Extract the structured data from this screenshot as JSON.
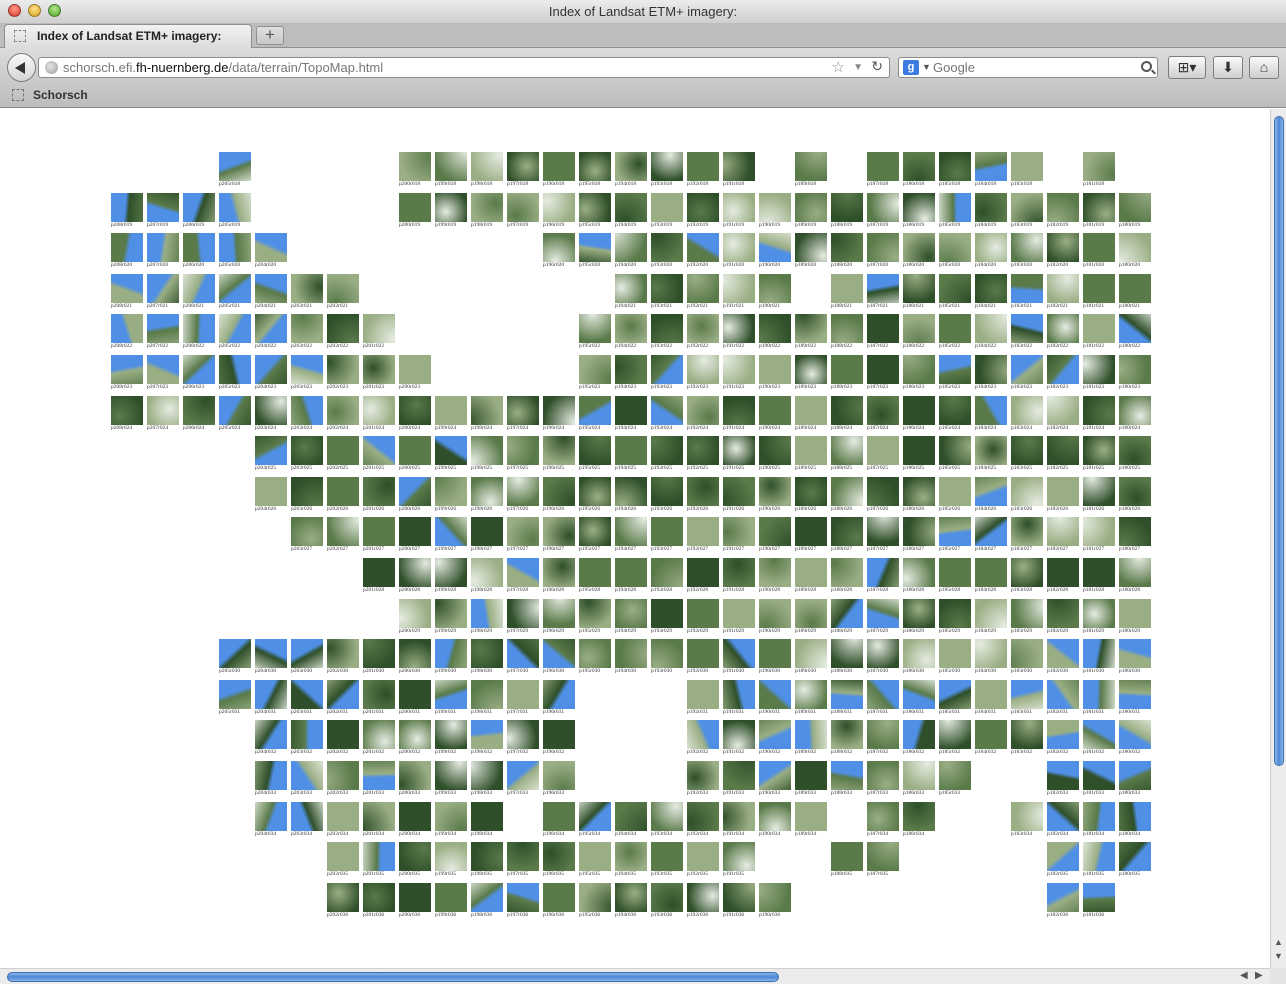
{
  "window": {
    "title": "Index of Landsat ETM+ imagery:"
  },
  "tabs": [
    {
      "label": "Index of Landsat ETM+ imagery:"
    }
  ],
  "navigation": {
    "url_prefix": "schorsch.efi.",
    "url_domain": "fh-nuernberg.de",
    "url_path": "/data/terrain/TopoMap.html",
    "search_placeholder": "Google",
    "search_engine_icon": "google-icon"
  },
  "bookmarks": [
    {
      "label": "Schorsch"
    }
  ],
  "colors": {
    "water": "#4f8fe6",
    "forest_dark": "#2f4f2a",
    "forest": "#5a7a4a",
    "field": "#9aae84",
    "snow": "#e6ece2",
    "scene_frame": "#000000"
  },
  "grid": {
    "rows": [
      "018",
      "019",
      "020",
      "021",
      "022",
      "023",
      "024",
      "025",
      "026",
      "027",
      "028",
      "029",
      "030",
      "031",
      "032",
      "033",
      "034",
      "035",
      "036"
    ],
    "paths": [
      "208",
      "207",
      "206",
      "205",
      "204",
      "203",
      "202",
      "201",
      "200",
      "199",
      "198",
      "197",
      "196",
      "195",
      "194",
      "193",
      "192",
      "191",
      "190",
      "189",
      "188",
      "187",
      "186",
      "185",
      "184",
      "183",
      "182",
      "181",
      "180"
    ],
    "row_presence": [
      "...x....xxxxxxxxxx.x.xxxxx.x.x",
      "xxxx....xxxxxxxxxxxxxxxxxxxxxx",
      "xxxxx.......xxxxxxxxxxxxxxxxxx",
      "xxxxxxx.......xxxxx.xxxxxxxxxx",
      "xxxxxxxx.....xxxxxxxxxxxxxxxxxx",
      "xxxxxxxxx....xxxxxxxxxxxxxxxxxx",
      "xxxxxxxxxxxxxxxxxxxxxxxxxxxxxx",
      "....xxxxxxxxxxxxxxxxxxxxxxxxxx",
      "....xxxxxxxxxxxxxxxxxxxxxxxxxx",
      ".....xxxxxxxxxxxxxxxxxxxxxxxxx",
      ".......xxxxxxxxxxxxxxxxxxxxxxx",
      "........xxxxxxxxxxxxxxxxxxxxxx",
      "...xxxxxxxxxxxxxxxxxxxxxxxxxxx",
      "...xxxxxxxxxx...xxxxxxxxxxxxxx",
      "....xxxxxxxxx...xxxxxxxxxxxxxx",
      "....xxxxxxxxx...xxxxxxxx..xxxxx",
      "....xxxxxxx.xxxxxxxx.xx..xxxxx",
      "......xxxxxxxxxxxx..xx....xxxx",
      "......xxxxxxxxxxxxx.......xx.."
    ]
  }
}
